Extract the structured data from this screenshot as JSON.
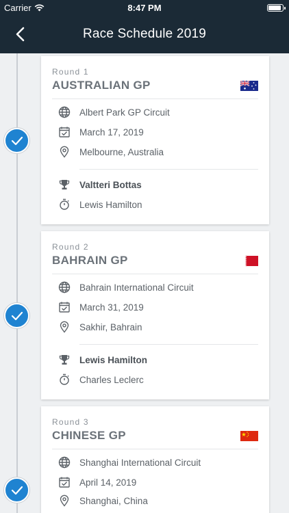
{
  "status_bar": {
    "carrier": "Carrier",
    "time": "8:47 PM"
  },
  "nav": {
    "title": "Race Schedule 2019"
  },
  "races": [
    {
      "round": "Round 1",
      "name": "AUSTRALIAN GP",
      "flag": "australia-flag",
      "circuit": "Albert Park GP Circuit",
      "date": "March 17, 2019",
      "location": "Melbourne, Australia",
      "winner": "Valtteri Bottas",
      "fastest_lap": "Lewis Hamilton",
      "completed": true
    },
    {
      "round": "Round 2",
      "name": "BAHRAIN GP",
      "flag": "bahrain-flag",
      "circuit": "Bahrain International Circuit",
      "date": "March 31, 2019",
      "location": "Sakhir, Bahrain",
      "winner": "Lewis Hamilton",
      "fastest_lap": "Charles Leclerc",
      "completed": true
    },
    {
      "round": "Round 3",
      "name": "CHINESE GP",
      "flag": "china-flag",
      "circuit": "Shanghai International Circuit",
      "date": "April 14, 2019",
      "location": "Shanghai, China",
      "completed": true
    }
  ],
  "colors": {
    "nav_bg": "#1b2a36",
    "accent": "#1f83d1",
    "background": "#eef0f2"
  }
}
